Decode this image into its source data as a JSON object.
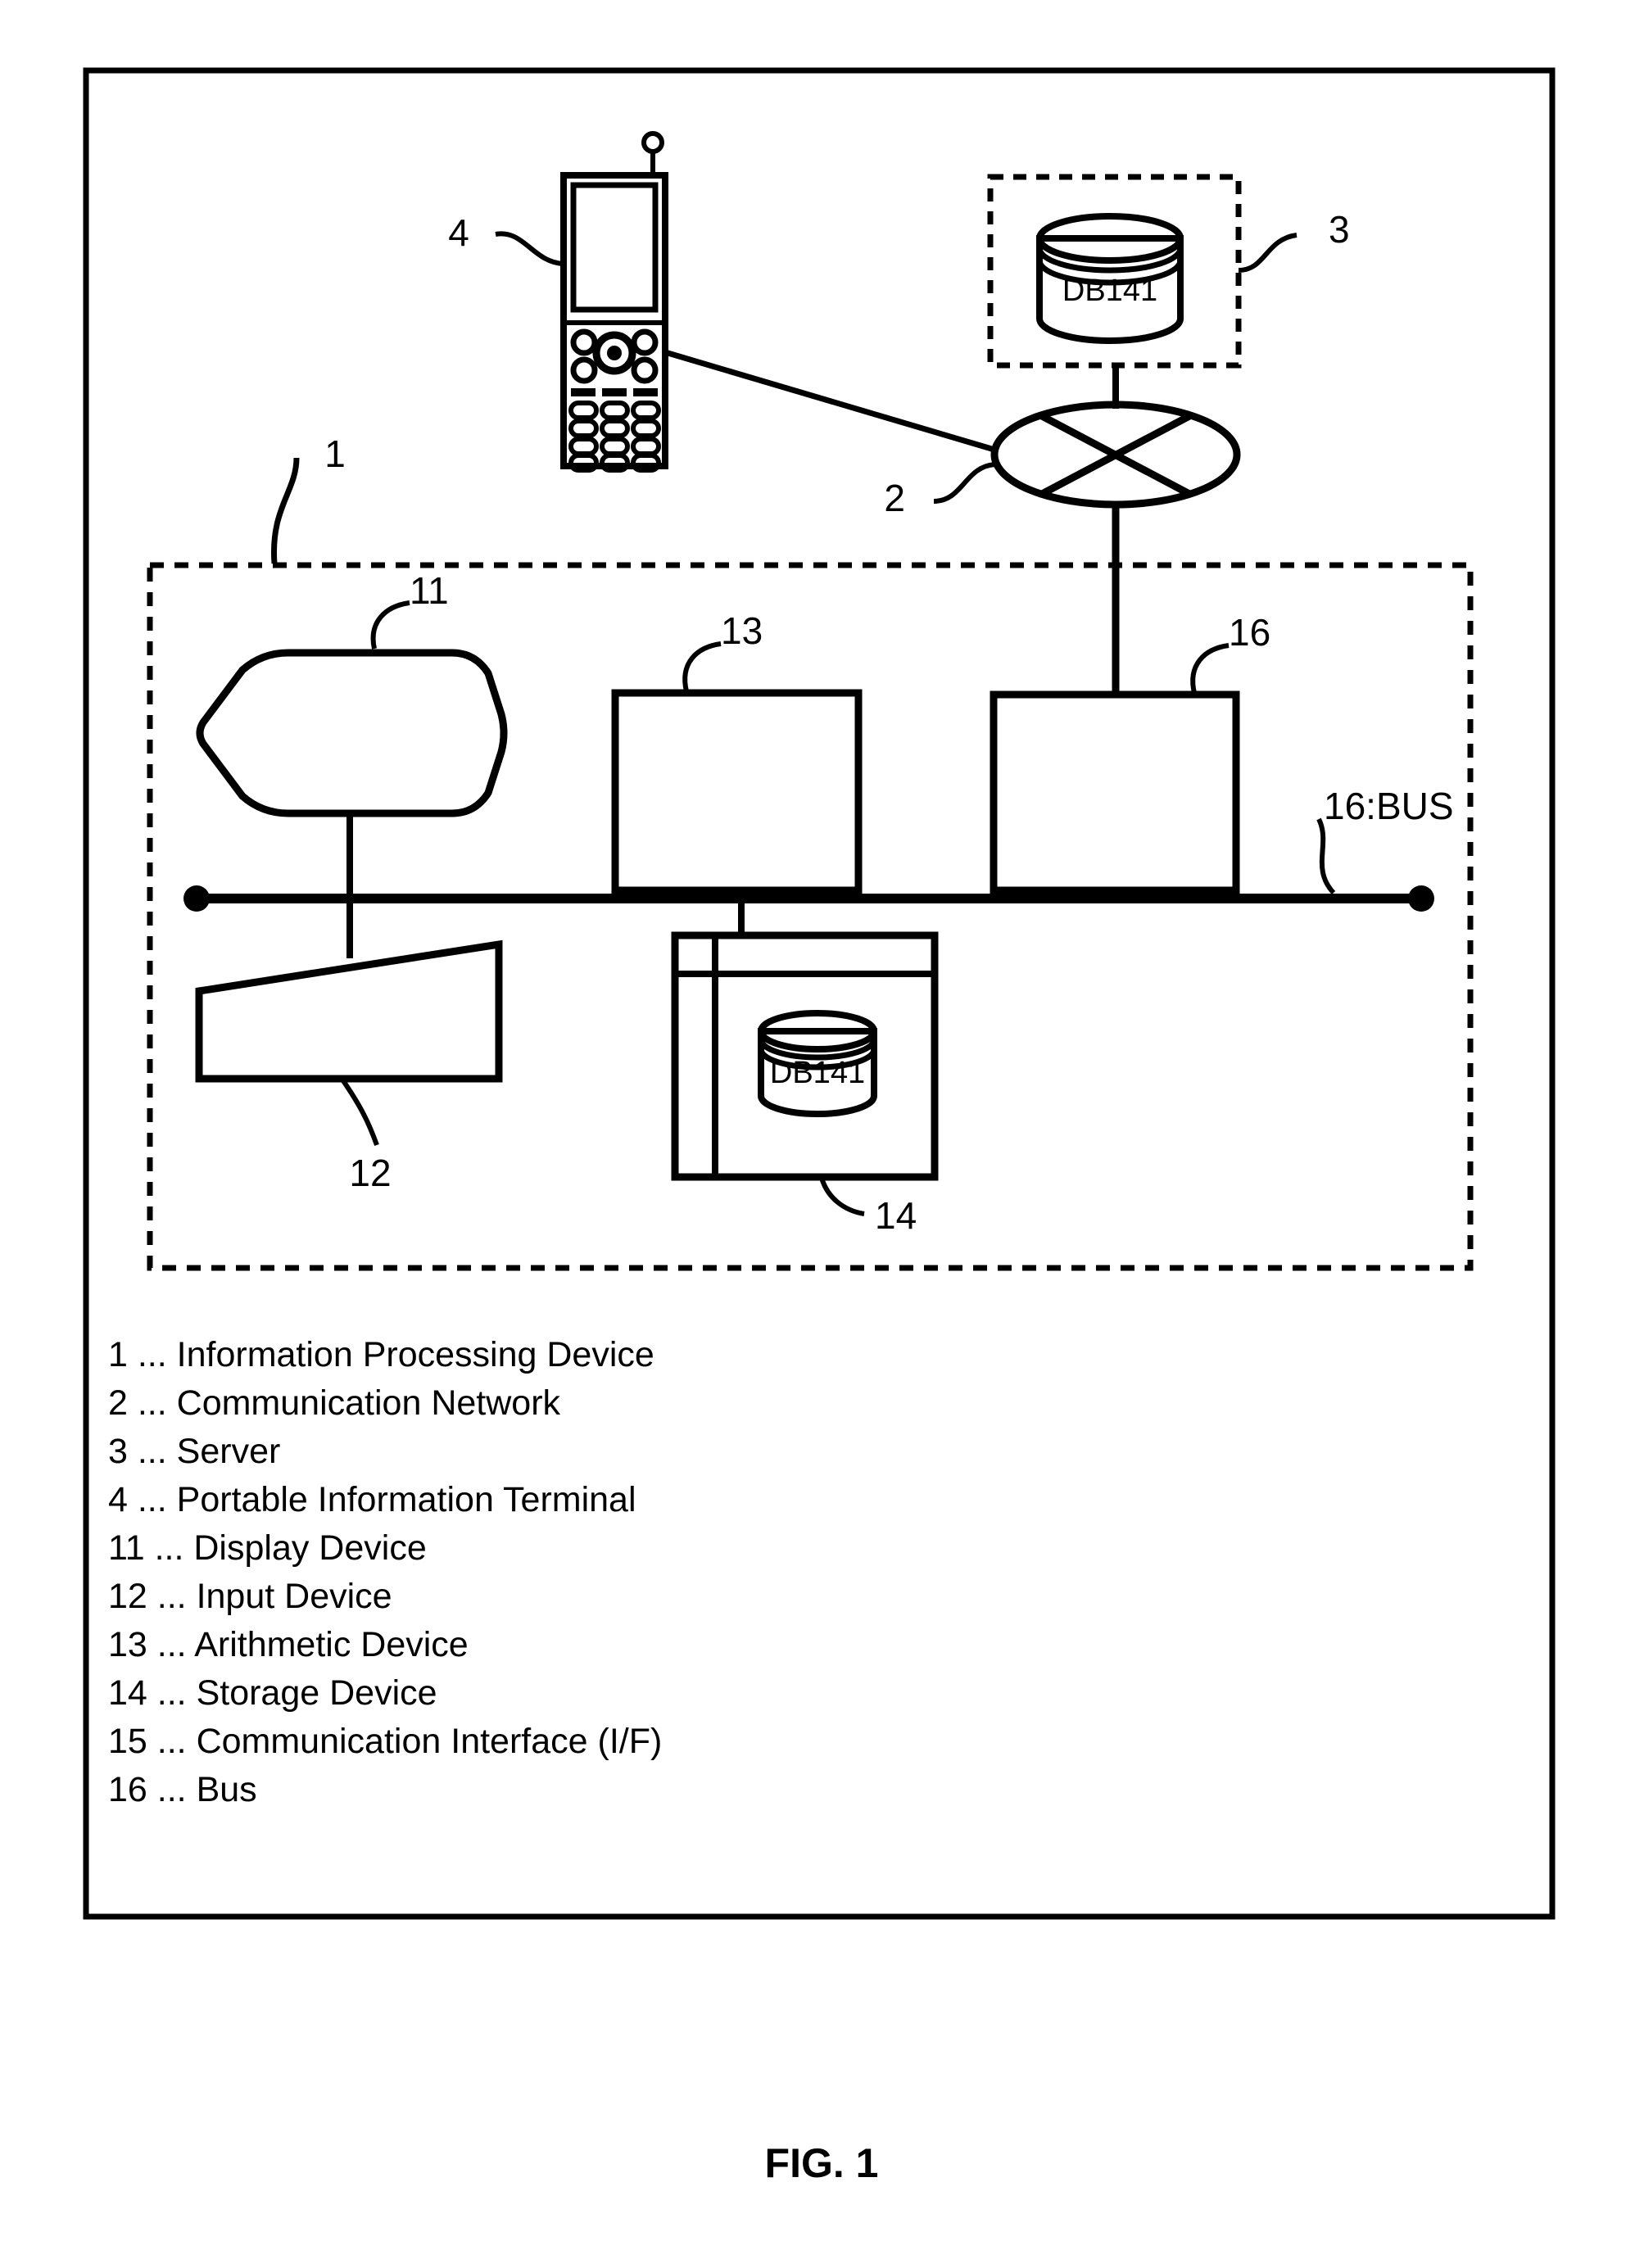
{
  "figure": {
    "caption": "FIG. 1",
    "title_number": "1"
  },
  "diagram": {
    "type": "patent-block-diagram",
    "callouts": {
      "device_1": "1",
      "network_2": "2",
      "server_3": "3",
      "terminal_4": "4",
      "display_11": "11",
      "input_12": "12",
      "arithmetic_13": "13",
      "storage_14": "14",
      "comm_if_16": "16",
      "bus_label": "16:BUS"
    },
    "db_label_server": "DB141",
    "db_label_storage": "DB141",
    "icons": {
      "terminal": "mobile-phone-icon",
      "network": "network-cloud-ellipse-icon",
      "server_db": "database-cylinder-icon",
      "display": "crt-monitor-icon",
      "input": "keyboard-icon",
      "arithmetic": "rectangle-block-icon",
      "storage": "storage-box-icon",
      "comm_if": "rectangle-block-icon",
      "bus": "bus-line-icon"
    },
    "colors": {
      "ink": "#000000",
      "paper": "#ffffff"
    }
  },
  "legend": {
    "items": [
      {
        "num": "1",
        "sep": "...",
        "label": "Information Processing Device"
      },
      {
        "num": "2",
        "sep": "...",
        "label": "Communication Network"
      },
      {
        "num": "3",
        "sep": "...",
        "label": "Server"
      },
      {
        "num": "4",
        "sep": "...",
        "label": "Portable Information Terminal"
      },
      {
        "num": "11",
        "sep": "...",
        "label": "Display Device"
      },
      {
        "num": "12",
        "sep": "...",
        "label": "Input Device"
      },
      {
        "num": "13",
        "sep": "...",
        "label": "Arithmetic Device"
      },
      {
        "num": "14",
        "sep": "...",
        "label": "Storage Device"
      },
      {
        "num": "15",
        "sep": "...",
        "label": "Communication Interface (I/F)"
      },
      {
        "num": "16",
        "sep": "...",
        "label": "Bus"
      }
    ],
    "rows": [
      "1 ... Information Processing Device",
      "2 ... Communication Network",
      "3 ... Server",
      "4 ... Portable Information Terminal",
      "11 ... Display Device",
      "12 ... Input Device",
      "13 ... Arithmetic Device",
      "14 ... Storage Device",
      "15 ... Communication Interface (I/F)",
      "16 ... Bus"
    ]
  }
}
